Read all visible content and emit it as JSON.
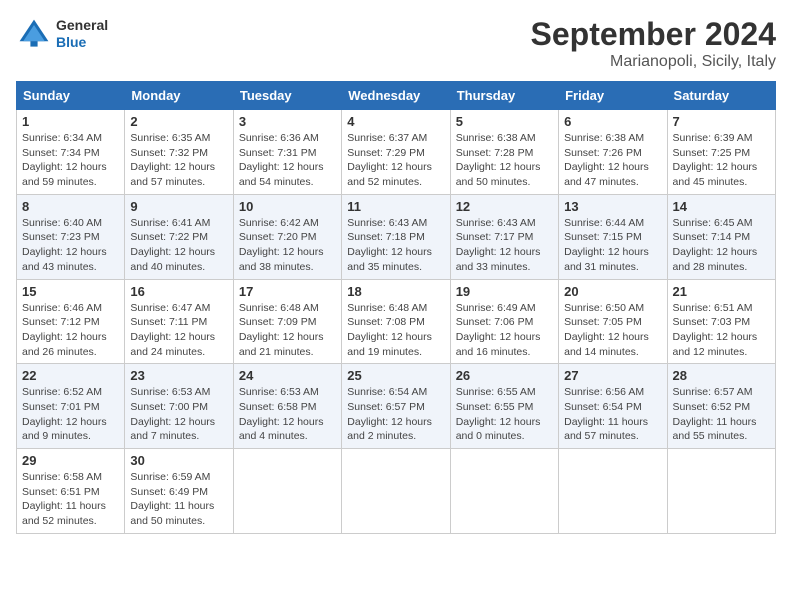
{
  "header": {
    "logo_line1": "General",
    "logo_line2": "Blue",
    "month_title": "September 2024",
    "location": "Marianopoli, Sicily, Italy"
  },
  "calendar": {
    "days_of_week": [
      "Sunday",
      "Monday",
      "Tuesday",
      "Wednesday",
      "Thursday",
      "Friday",
      "Saturday"
    ],
    "weeks": [
      [
        {
          "day": "1",
          "info": "Sunrise: 6:34 AM\nSunset: 7:34 PM\nDaylight: 12 hours\nand 59 minutes."
        },
        {
          "day": "2",
          "info": "Sunrise: 6:35 AM\nSunset: 7:32 PM\nDaylight: 12 hours\nand 57 minutes."
        },
        {
          "day": "3",
          "info": "Sunrise: 6:36 AM\nSunset: 7:31 PM\nDaylight: 12 hours\nand 54 minutes."
        },
        {
          "day": "4",
          "info": "Sunrise: 6:37 AM\nSunset: 7:29 PM\nDaylight: 12 hours\nand 52 minutes."
        },
        {
          "day": "5",
          "info": "Sunrise: 6:38 AM\nSunset: 7:28 PM\nDaylight: 12 hours\nand 50 minutes."
        },
        {
          "day": "6",
          "info": "Sunrise: 6:38 AM\nSunset: 7:26 PM\nDaylight: 12 hours\nand 47 minutes."
        },
        {
          "day": "7",
          "info": "Sunrise: 6:39 AM\nSunset: 7:25 PM\nDaylight: 12 hours\nand 45 minutes."
        }
      ],
      [
        {
          "day": "8",
          "info": "Sunrise: 6:40 AM\nSunset: 7:23 PM\nDaylight: 12 hours\nand 43 minutes."
        },
        {
          "day": "9",
          "info": "Sunrise: 6:41 AM\nSunset: 7:22 PM\nDaylight: 12 hours\nand 40 minutes."
        },
        {
          "day": "10",
          "info": "Sunrise: 6:42 AM\nSunset: 7:20 PM\nDaylight: 12 hours\nand 38 minutes."
        },
        {
          "day": "11",
          "info": "Sunrise: 6:43 AM\nSunset: 7:18 PM\nDaylight: 12 hours\nand 35 minutes."
        },
        {
          "day": "12",
          "info": "Sunrise: 6:43 AM\nSunset: 7:17 PM\nDaylight: 12 hours\nand 33 minutes."
        },
        {
          "day": "13",
          "info": "Sunrise: 6:44 AM\nSunset: 7:15 PM\nDaylight: 12 hours\nand 31 minutes."
        },
        {
          "day": "14",
          "info": "Sunrise: 6:45 AM\nSunset: 7:14 PM\nDaylight: 12 hours\nand 28 minutes."
        }
      ],
      [
        {
          "day": "15",
          "info": "Sunrise: 6:46 AM\nSunset: 7:12 PM\nDaylight: 12 hours\nand 26 minutes."
        },
        {
          "day": "16",
          "info": "Sunrise: 6:47 AM\nSunset: 7:11 PM\nDaylight: 12 hours\nand 24 minutes."
        },
        {
          "day": "17",
          "info": "Sunrise: 6:48 AM\nSunset: 7:09 PM\nDaylight: 12 hours\nand 21 minutes."
        },
        {
          "day": "18",
          "info": "Sunrise: 6:48 AM\nSunset: 7:08 PM\nDaylight: 12 hours\nand 19 minutes."
        },
        {
          "day": "19",
          "info": "Sunrise: 6:49 AM\nSunset: 7:06 PM\nDaylight: 12 hours\nand 16 minutes."
        },
        {
          "day": "20",
          "info": "Sunrise: 6:50 AM\nSunset: 7:05 PM\nDaylight: 12 hours\nand 14 minutes."
        },
        {
          "day": "21",
          "info": "Sunrise: 6:51 AM\nSunset: 7:03 PM\nDaylight: 12 hours\nand 12 minutes."
        }
      ],
      [
        {
          "day": "22",
          "info": "Sunrise: 6:52 AM\nSunset: 7:01 PM\nDaylight: 12 hours\nand 9 minutes."
        },
        {
          "day": "23",
          "info": "Sunrise: 6:53 AM\nSunset: 7:00 PM\nDaylight: 12 hours\nand 7 minutes."
        },
        {
          "day": "24",
          "info": "Sunrise: 6:53 AM\nSunset: 6:58 PM\nDaylight: 12 hours\nand 4 minutes."
        },
        {
          "day": "25",
          "info": "Sunrise: 6:54 AM\nSunset: 6:57 PM\nDaylight: 12 hours\nand 2 minutes."
        },
        {
          "day": "26",
          "info": "Sunrise: 6:55 AM\nSunset: 6:55 PM\nDaylight: 12 hours\nand 0 minutes."
        },
        {
          "day": "27",
          "info": "Sunrise: 6:56 AM\nSunset: 6:54 PM\nDaylight: 11 hours\nand 57 minutes."
        },
        {
          "day": "28",
          "info": "Sunrise: 6:57 AM\nSunset: 6:52 PM\nDaylight: 11 hours\nand 55 minutes."
        }
      ],
      [
        {
          "day": "29",
          "info": "Sunrise: 6:58 AM\nSunset: 6:51 PM\nDaylight: 11 hours\nand 52 minutes."
        },
        {
          "day": "30",
          "info": "Sunrise: 6:59 AM\nSunset: 6:49 PM\nDaylight: 11 hours\nand 50 minutes."
        },
        {
          "day": "",
          "info": ""
        },
        {
          "day": "",
          "info": ""
        },
        {
          "day": "",
          "info": ""
        },
        {
          "day": "",
          "info": ""
        },
        {
          "day": "",
          "info": ""
        }
      ]
    ]
  }
}
